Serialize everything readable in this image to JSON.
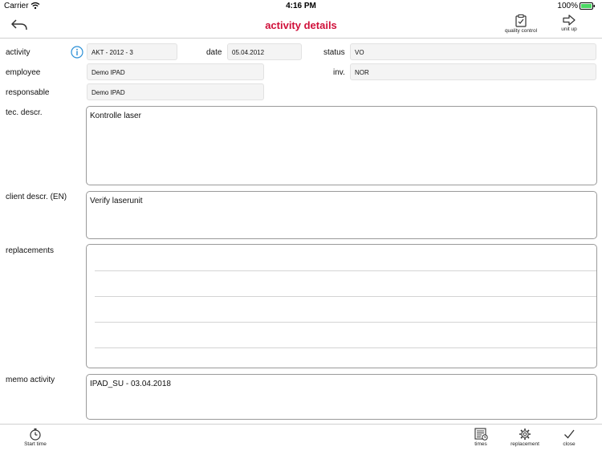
{
  "status_bar": {
    "carrier": "Carrier",
    "time": "4:16 PM",
    "battery": "100%"
  },
  "nav": {
    "title": "activity details",
    "quality_control": "quality control",
    "unit_up": "unit up"
  },
  "form": {
    "activity_label": "activity",
    "activity_value": "AKT - 2012 - 3",
    "date_label": "date",
    "date_value": "05.04.2012",
    "status_label": "status",
    "status_value": "VO",
    "employee_label": "employee",
    "employee_value": "Demo IPAD",
    "inv_label": "inv.",
    "inv_value": "NOR",
    "responsable_label": "responsable",
    "responsable_value": "Demo IPAD",
    "tec_descr_label": "tec. descr.",
    "tec_descr_value": "Kontrolle laser",
    "client_descr_label": "client descr.  (EN)",
    "client_descr_value": "Verify laserunit",
    "replacements_label": "replacements",
    "memo_label": "memo activity",
    "memo_value": "IPAD_SU - 03.04.2018"
  },
  "toolbar": {
    "start_time": "Start time",
    "times": "times",
    "replacement": "replacement",
    "close": "close"
  },
  "colors": {
    "accent": "#d0103a",
    "info": "#2a8fd6",
    "battery": "#4cd964"
  },
  "icons": [
    "wifi-icon",
    "battery-icon",
    "back-arrow-icon",
    "clipboard-check-icon",
    "arrow-right-icon",
    "info-icon",
    "stopwatch-icon",
    "list-clock-icon",
    "gear-icon",
    "checkmark-icon"
  ]
}
